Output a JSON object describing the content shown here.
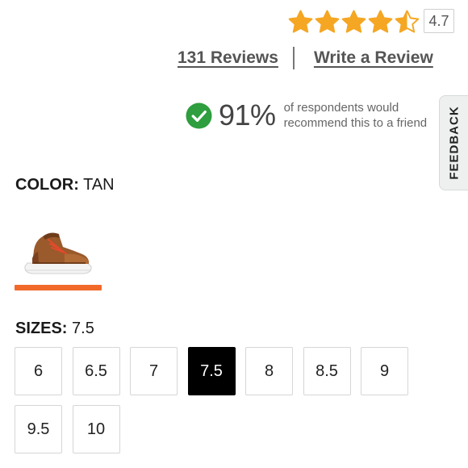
{
  "rating": {
    "value": "4.7",
    "stars": 4.7,
    "star_color": "#f5a623"
  },
  "reviews": {
    "count_label": "131 Reviews",
    "write_label": "Write a Review"
  },
  "recommend": {
    "percent": "91%",
    "text_line1": "of respondents would",
    "text_line2": "recommend this to a friend",
    "icon": "check-circle-icon",
    "icon_color": "#2e9e3e"
  },
  "feedback": {
    "label": "FEEDBACK"
  },
  "color": {
    "key": "COLOR:",
    "value": "TAN",
    "accent": "#f26a2a"
  },
  "sizes": {
    "key": "SIZES:",
    "selected": "7.5",
    "options": [
      "6",
      "6.5",
      "7",
      "7.5",
      "8",
      "8.5",
      "9",
      "9.5",
      "10"
    ]
  }
}
